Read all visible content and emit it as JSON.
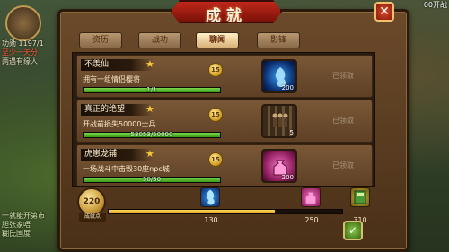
{
  "dialog": {
    "title": "成就",
    "close_label": "✕"
  },
  "tabs": [
    {
      "label": "资历"
    },
    {
      "label": "战功"
    },
    {
      "label": "聊闻"
    },
    {
      "label": "影锋"
    }
  ],
  "active_tab": 2,
  "achievements": [
    {
      "name": "不羡仙",
      "description": "拥有一组情侣樱将",
      "progress_text": "1/1",
      "progress": 1.0,
      "points": "15",
      "reward_icon": "blue-spirit-icon",
      "reward_count": "200",
      "status": "已领取"
    },
    {
      "name": "真正的绝望",
      "description": "开战前损失50000士兵",
      "progress_text": "53053/50000",
      "progress": 1.0,
      "points": "15",
      "reward_icon": "soldiers-icon",
      "reward_count": "5",
      "status": "已领取"
    },
    {
      "name": "虎崽龙辅",
      "description": "一场战斗中击毁30座npc城",
      "progress_text": "30/30",
      "progress": 1.0,
      "points": "15",
      "reward_icon": "pink-bag-icon",
      "reward_count": "200",
      "status": "已领取"
    }
  ],
  "summary": {
    "points_value": "220",
    "points_label": "成就点",
    "milestones": [
      {
        "value": "130",
        "icon": "blue-spirit-icon"
      },
      {
        "value": "250",
        "icon": "pink-bag-icon"
      },
      {
        "value": "310",
        "icon": "green-book-icon"
      }
    ],
    "progress_fraction": 0.71
  },
  "background": {
    "left_text": [
      "功勋 1197/1",
      "至少一天分",
      "两遇有缘人"
    ],
    "bottom_left_text": [
      "一就能开第市",
      "胆张家唔",
      "糊氏国度"
    ],
    "top_right_text": "00开战",
    "confirm_label": "✓"
  },
  "colors": {
    "accent_red": "#c0281a",
    "progress_green": "#5ab82a",
    "progress_gold": "#e8b030",
    "claimed_text": "#a8947a"
  }
}
